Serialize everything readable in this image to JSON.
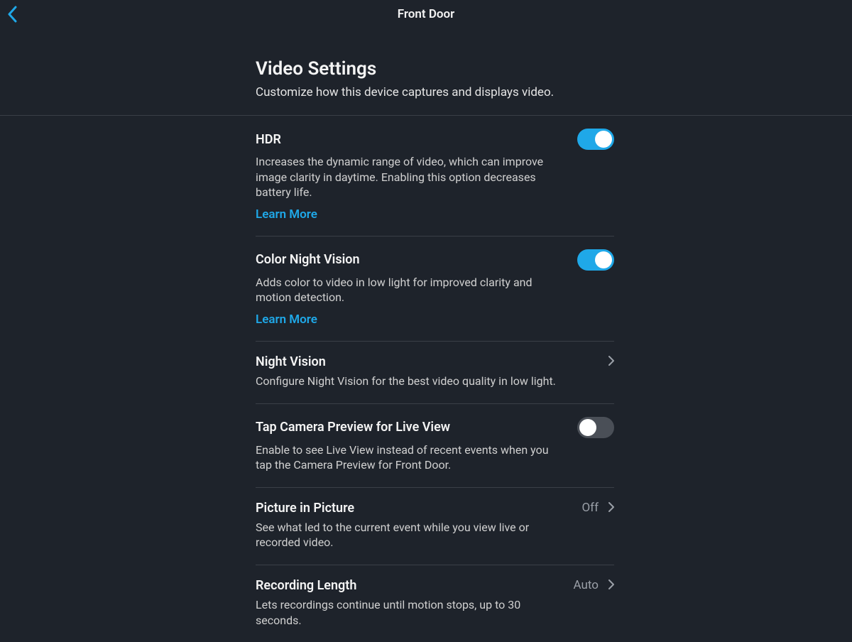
{
  "header": {
    "title": "Front Door"
  },
  "page": {
    "title": "Video Settings",
    "subtitle": "Customize how this device captures and displays video."
  },
  "links": {
    "learn_more": "Learn More"
  },
  "settings": {
    "hdr": {
      "title": "HDR",
      "desc": "Increases the dynamic range of video, which can improve image clarity in daytime. Enabling this option decreases battery life.",
      "enabled": true
    },
    "color_night_vision": {
      "title": "Color Night Vision",
      "desc": "Adds color to video in low light for improved clarity and motion detection.",
      "enabled": true
    },
    "night_vision": {
      "title": "Night Vision",
      "desc": "Configure Night Vision for the best video quality in low light."
    },
    "tap_preview": {
      "title": "Tap Camera Preview for Live View",
      "desc": "Enable to see Live View instead of recent events when you tap the Camera Preview for Front Door.",
      "enabled": false
    },
    "pip": {
      "title": "Picture in Picture",
      "desc": "See what led to the current event while you view live or recorded video.",
      "value": "Off"
    },
    "recording_length": {
      "title": "Recording Length",
      "desc": "Lets recordings continue until motion stops, up to 30 seconds.",
      "value": "Auto"
    }
  },
  "colors": {
    "accent": "#1fa8e8",
    "bg": "#1e232b"
  }
}
